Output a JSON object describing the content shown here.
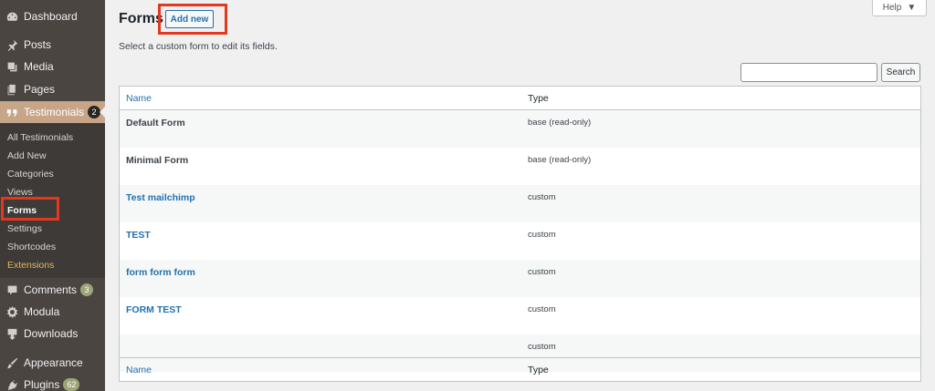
{
  "sidebar": {
    "items": [
      {
        "label": "Dashboard",
        "icon": "dashboard-icon"
      },
      {
        "label": "Posts",
        "icon": "pin-icon"
      },
      {
        "label": "Media",
        "icon": "media-icon"
      },
      {
        "label": "Pages",
        "icon": "pages-icon"
      },
      {
        "label": "Testimonials",
        "icon": "quote-icon",
        "badge": "2"
      },
      {
        "label": "Comments",
        "icon": "comment-icon",
        "badge": "3"
      },
      {
        "label": "Modula",
        "icon": "gear-icon"
      },
      {
        "label": "Downloads",
        "icon": "download-icon"
      },
      {
        "label": "Appearance",
        "icon": "brush-icon"
      },
      {
        "label": "Plugins",
        "icon": "plug-icon",
        "badge": "62"
      }
    ],
    "submenu": [
      "All Testimonials",
      "Add New",
      "Categories",
      "Views",
      "Forms",
      "Settings",
      "Shortcodes",
      "Extensions"
    ]
  },
  "header": {
    "title": "Forms",
    "add_new_label": "Add new",
    "help_label": "Help",
    "subtitle": "Select a custom form to edit its fields."
  },
  "search": {
    "button_label": "Search",
    "value": ""
  },
  "table": {
    "columns": [
      "Name",
      "Type"
    ],
    "rows": [
      {
        "name": "Default Form",
        "type": "base (read-only)"
      },
      {
        "name": "Minimal Form",
        "type": "base (read-only)"
      },
      {
        "name": "Test mailchimp",
        "type": "custom"
      },
      {
        "name": "TEST",
        "type": "custom"
      },
      {
        "name": "form form form",
        "type": "custom"
      },
      {
        "name": "FORM TEST",
        "type": "custom"
      },
      {
        "name": "",
        "type": "custom"
      }
    ]
  },
  "colors": {
    "sidebar_bg": "#4a4541",
    "active_bg": "#c7a589",
    "link": "#2271b1",
    "highlight_box": "#e0391f"
  }
}
